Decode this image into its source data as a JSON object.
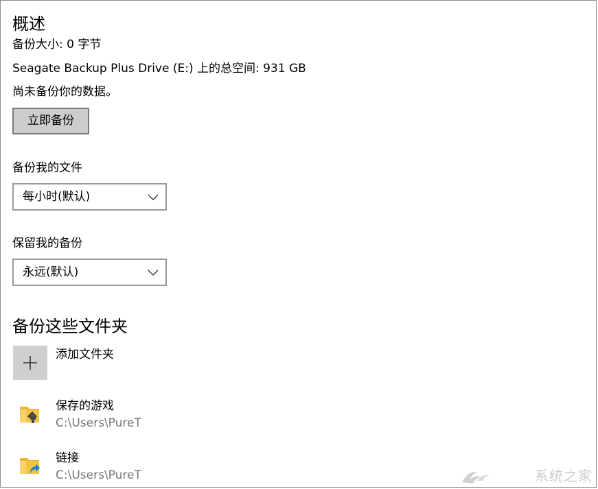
{
  "overview": {
    "title": "概述",
    "backup_size": "备份大小: 0 字节",
    "total_space": "Seagate Backup Plus Drive (E:) 上的总空间: 931 GB",
    "status": "尚未备份你的数据。",
    "backup_now_label": "立即备份"
  },
  "backup_files": {
    "label": "备份我的文件",
    "selected": "每小时(默认)"
  },
  "keep_backups": {
    "label": "保留我的备份",
    "selected": "永远(默认)"
  },
  "folders": {
    "title": "备份这些文件夹",
    "add_label": "添加文件夹",
    "items": [
      {
        "name": "保存的游戏",
        "path": "C:\\Users\\PureT",
        "icon": "saved-games-folder-icon"
      },
      {
        "name": "链接",
        "path": "C:\\Users\\PureT",
        "icon": "links-folder-icon"
      }
    ]
  },
  "watermark": "系统之家",
  "colors": {
    "button_bg": "#cccccc",
    "tile_bg": "#cfcfcf",
    "path_text": "#767676",
    "folder_yellow": "#f4c445",
    "link_arrow": "#1e7fd4"
  }
}
